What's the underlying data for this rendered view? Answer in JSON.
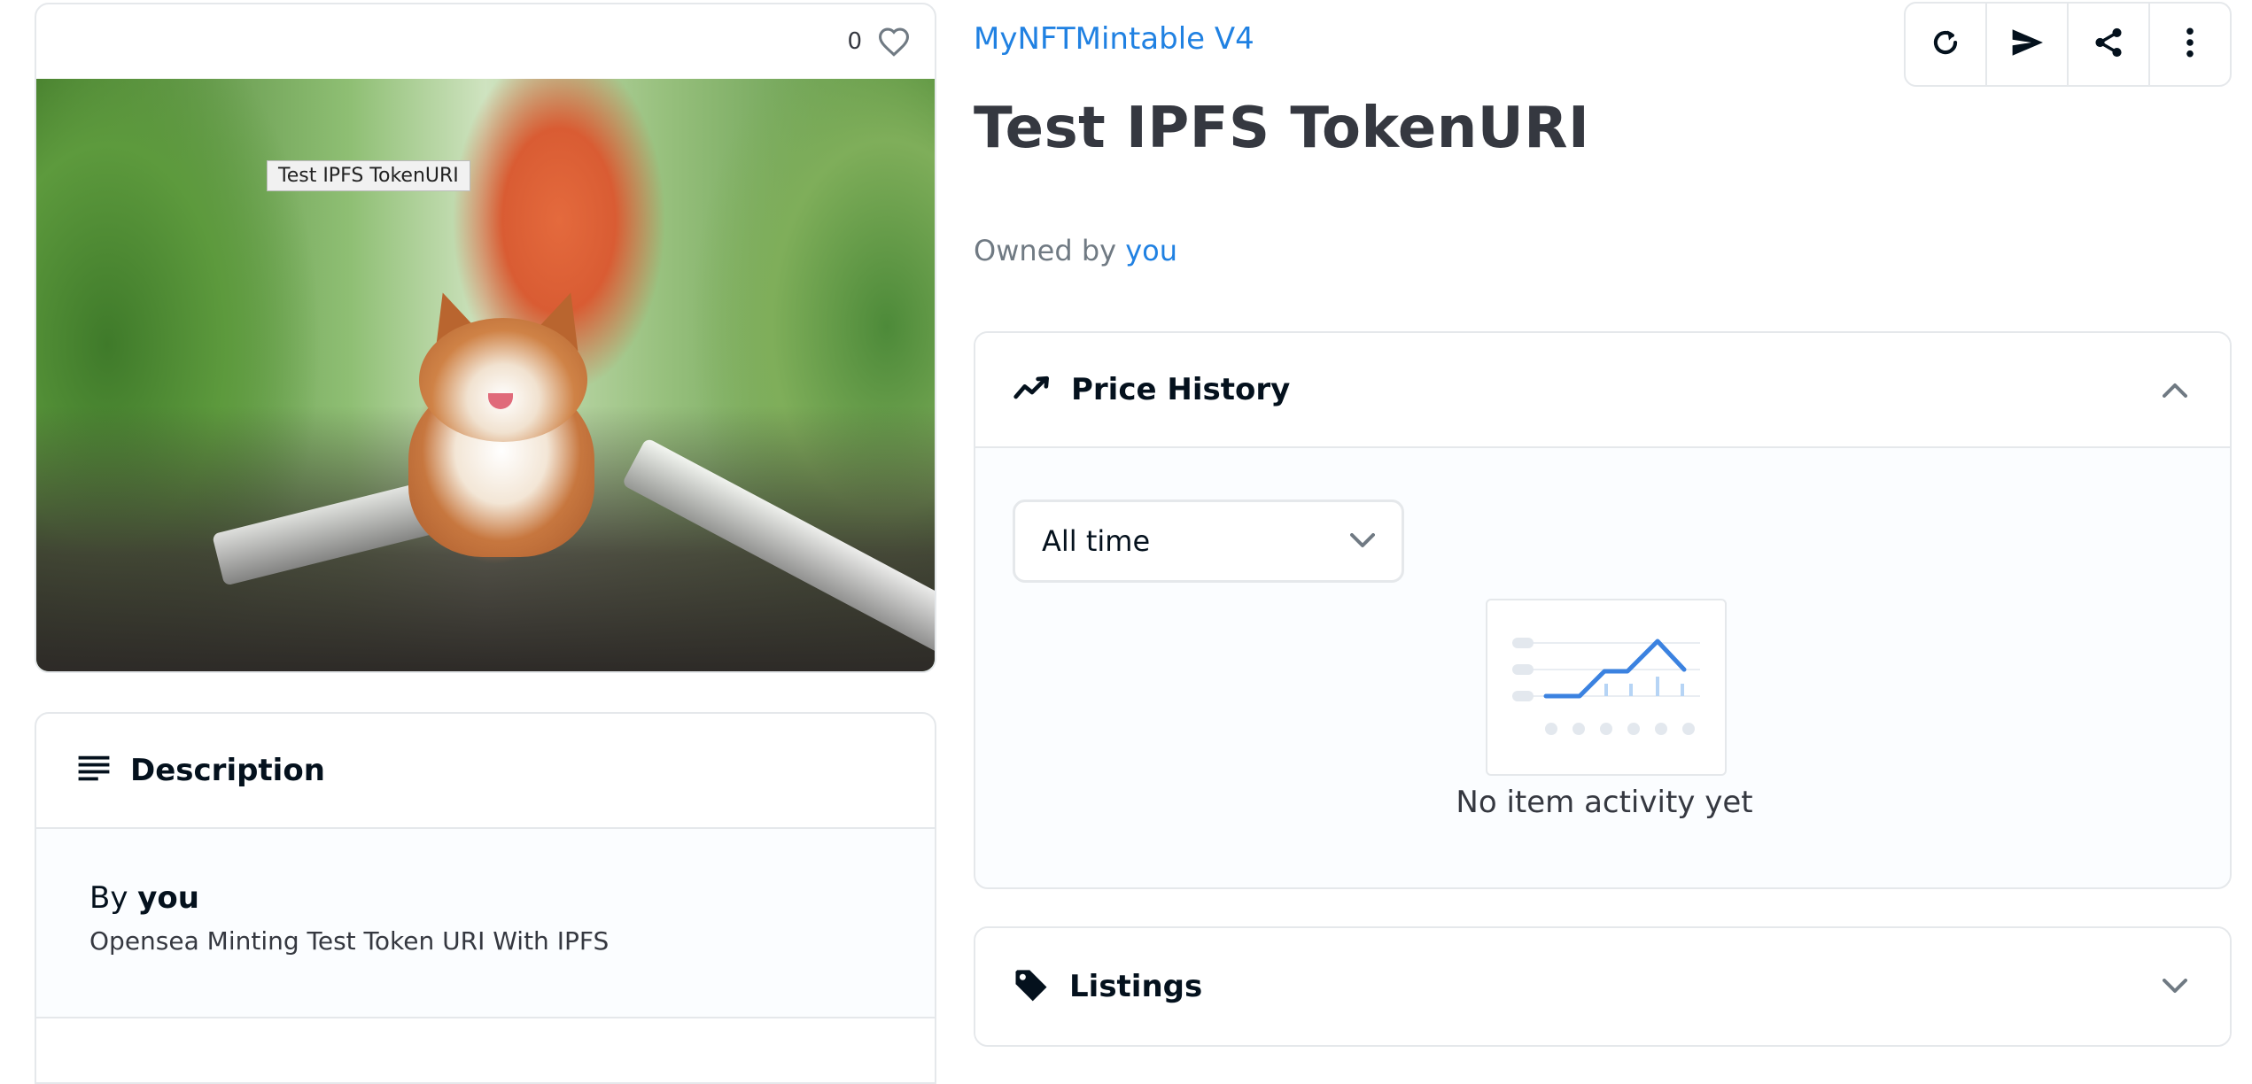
{
  "media": {
    "favorite_count": "0",
    "tooltip_text": "Test IPFS TokenURI"
  },
  "description": {
    "header_label": "Description",
    "by_prefix": "By",
    "by_name": "you",
    "text": "Opensea Minting Test Token URI With IPFS"
  },
  "item": {
    "collection_name": "MyNFTMintable V4",
    "title": "Test IPFS TokenURI",
    "owned_by_prefix": "Owned by",
    "owner": "you"
  },
  "actions": {
    "icons": [
      "refresh-icon",
      "send-icon",
      "share-icon",
      "more-vertical-icon"
    ]
  },
  "price_history": {
    "header_label": "Price History",
    "time_filter": "All time",
    "empty_state": "No item activity yet"
  },
  "listings": {
    "header_label": "Listings"
  },
  "colors": {
    "accent": "#2081e2",
    "border": "#e5e8eb",
    "text_primary": "#04111d",
    "text_secondary": "#707a83"
  }
}
